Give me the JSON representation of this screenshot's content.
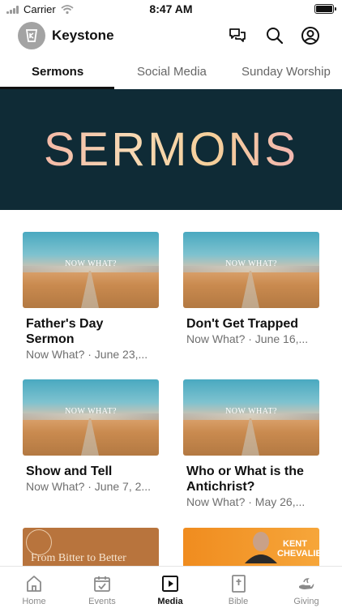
{
  "status_bar": {
    "carrier": "Carrier",
    "time": "8:47 AM"
  },
  "header": {
    "title": "Keystone",
    "icons": [
      "chat-icon",
      "search-icon",
      "profile-icon"
    ]
  },
  "tabs": [
    {
      "label": "Sermons",
      "active": true
    },
    {
      "label": "Social Media",
      "active": false
    },
    {
      "label": "Sunday Worship",
      "active": false
    }
  ],
  "banner": {
    "text": "SERMONS",
    "background": "#0f2b36"
  },
  "sermons": [
    {
      "thumb_caption": "NOW WHAT?",
      "title": "Father's Day Sermon",
      "subtitle": "Now What? · June 23,..."
    },
    {
      "thumb_caption": "NOW WHAT?",
      "title": "Don't Get Trapped",
      "subtitle": "Now What? · June 16,..."
    },
    {
      "thumb_caption": "NOW WHAT?",
      "title": "Show and Tell",
      "subtitle": "Now What? · June 7, 2..."
    },
    {
      "thumb_caption": "NOW WHAT?",
      "title": "Who or What is the Antichrist?",
      "subtitle": "Now What? · May 26,..."
    }
  ],
  "partial_cards": [
    {
      "thumb_caption": "From Bitter to Better"
    },
    {
      "thumb_caption": "KENT CHEVALIER"
    }
  ],
  "bottom_nav": [
    {
      "label": "Home",
      "icon": "home-icon",
      "active": false
    },
    {
      "label": "Events",
      "icon": "calendar-icon",
      "active": false
    },
    {
      "label": "Media",
      "icon": "media-icon",
      "active": true
    },
    {
      "label": "Bible",
      "icon": "bible-icon",
      "active": false
    },
    {
      "label": "Giving",
      "icon": "giving-icon",
      "active": false
    }
  ],
  "colors": {
    "accent": "#111111",
    "inactive": "#8a8a8a"
  }
}
